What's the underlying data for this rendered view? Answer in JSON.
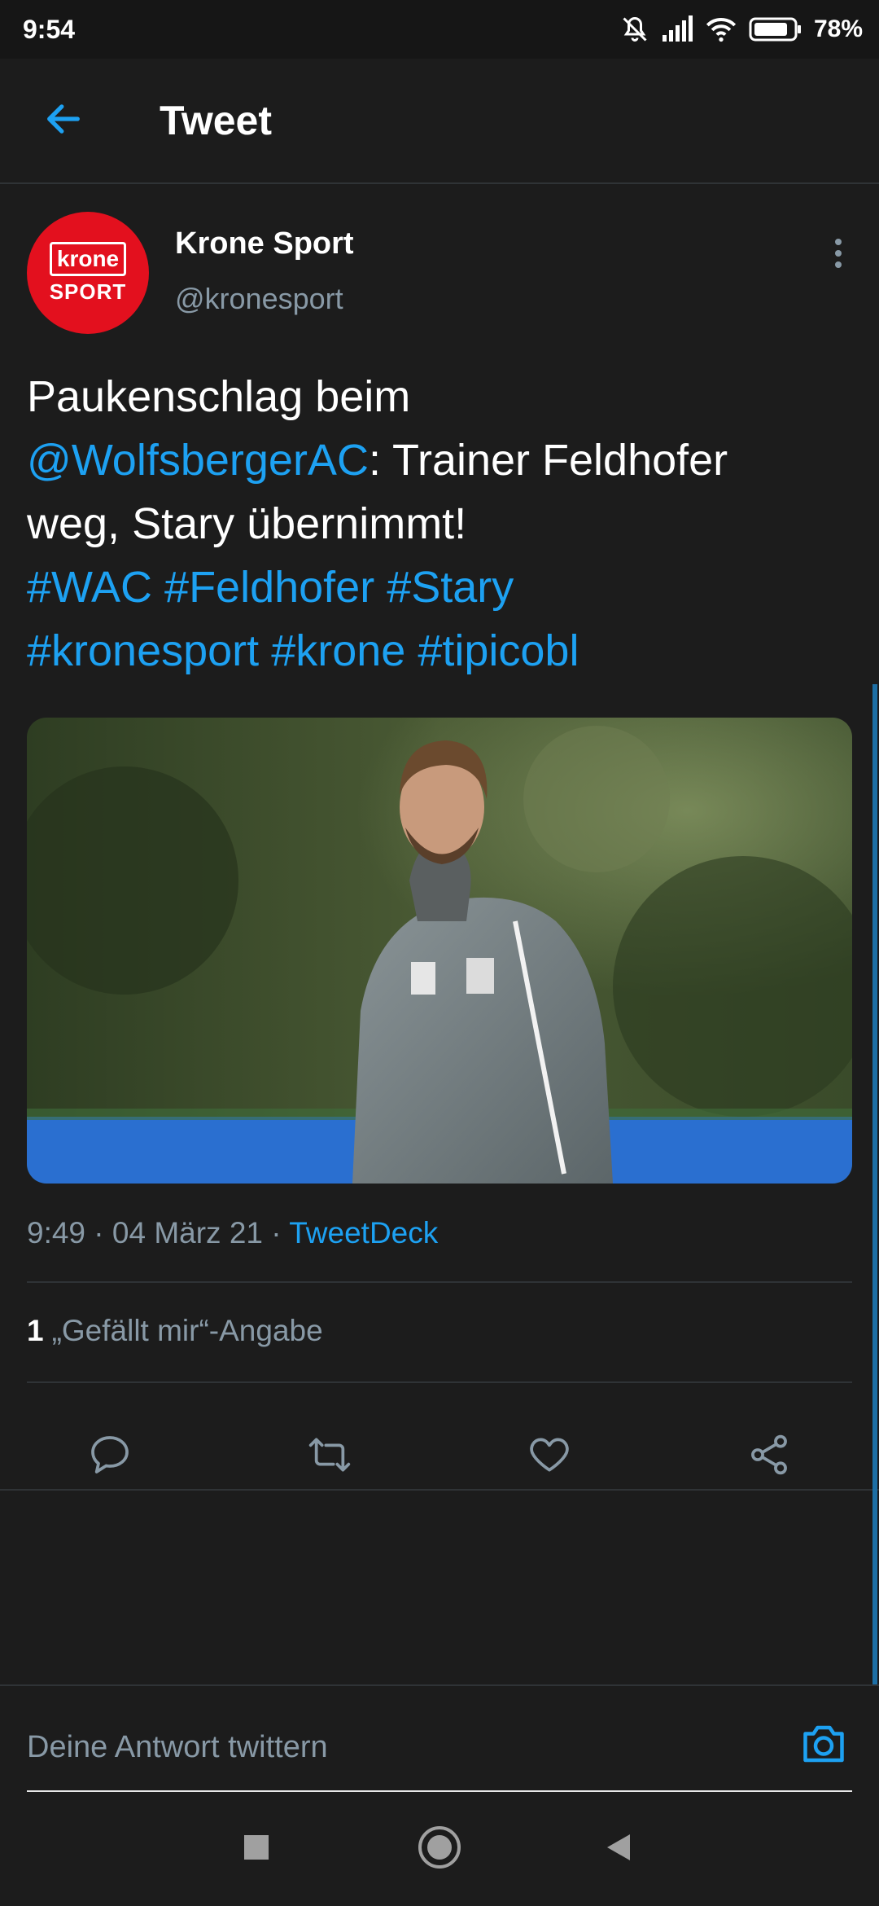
{
  "status_bar": {
    "time": "9:54",
    "battery": "78%"
  },
  "header": {
    "title": "Tweet"
  },
  "tweet": {
    "avatar": {
      "logo_top": "krone",
      "logo_bottom": "SPORT"
    },
    "author_name": "Krone Sport",
    "author_handle": "@kronesport",
    "text": {
      "line1": "Paukenschlag beim",
      "mention": "@WolfsbergerAC",
      "line2_rest": ": Trainer Feldhofer",
      "line3": "weg, Stary übernimmt!",
      "hashtags_line1": [
        "#WAC",
        "#Feldhofer",
        "#Stary"
      ],
      "hashtags_line2": [
        "#kronesport",
        "#krone",
        "#tipicobl"
      ]
    },
    "meta": {
      "time": "9:49",
      "date": "04 März 21",
      "separator": "·",
      "source": "TweetDeck"
    },
    "likes": {
      "count": "1",
      "label": "„Gefällt mir“-Angabe"
    }
  },
  "reply": {
    "placeholder": "Deine Antwort twittern"
  },
  "colors": {
    "background": "#1c1c1c",
    "accent": "#1da1f2",
    "secondary_text": "#8899a6",
    "avatar_red": "#e3101e"
  },
  "icons": {
    "back": "arrow-left-icon",
    "more": "more-vertical-icon",
    "reply": "reply-icon",
    "retweet": "retweet-icon",
    "like": "heart-icon",
    "share": "share-icon",
    "camera": "camera-icon"
  }
}
